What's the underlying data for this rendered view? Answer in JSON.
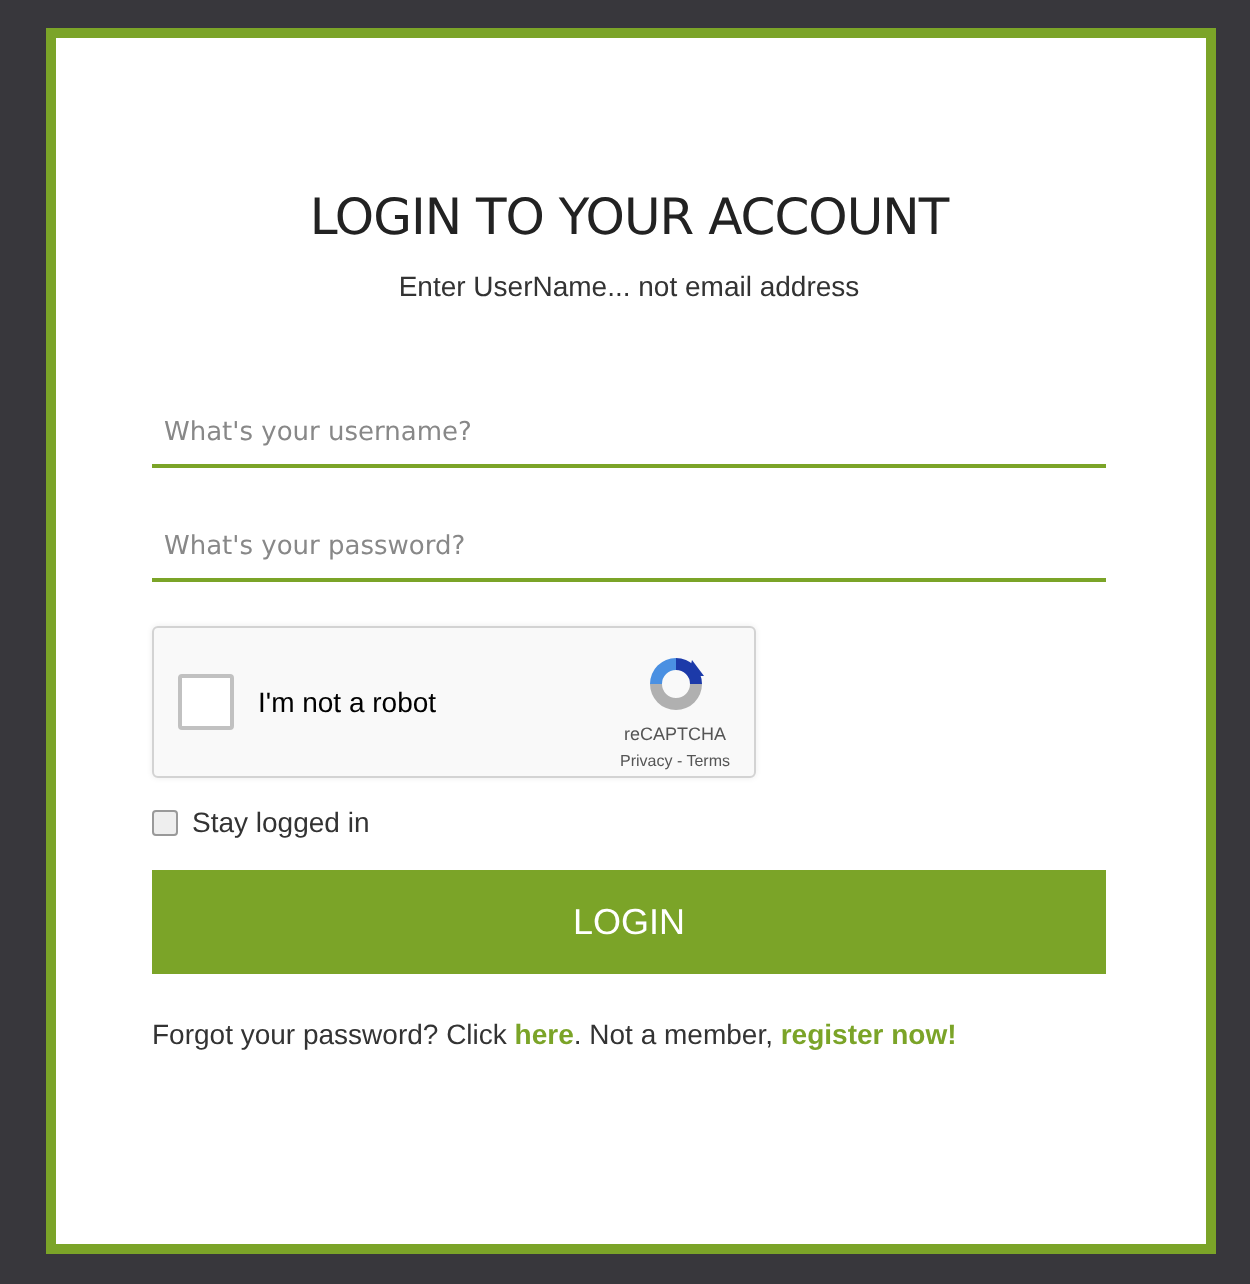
{
  "title": "LOGIN TO YOUR ACCOUNT",
  "subtitle": "Enter UserName... not email address",
  "fields": [
    {
      "placeholder": "What's your username?"
    },
    {
      "placeholder": "What's your password?"
    }
  ],
  "captcha": {
    "label": "I'm not a robot",
    "checked": false,
    "brand": "reCAPTCHA",
    "privacy": "Privacy",
    "separator": "-",
    "terms": "Terms"
  },
  "stay_logged_in": {
    "label": "Stay logged in",
    "checked": false
  },
  "login_button": "LOGIN",
  "footer": {
    "text_1": "Forgot your password? Click ",
    "link_1": "here",
    "text_2": ". Not a member, ",
    "link_2": "register now!"
  }
}
